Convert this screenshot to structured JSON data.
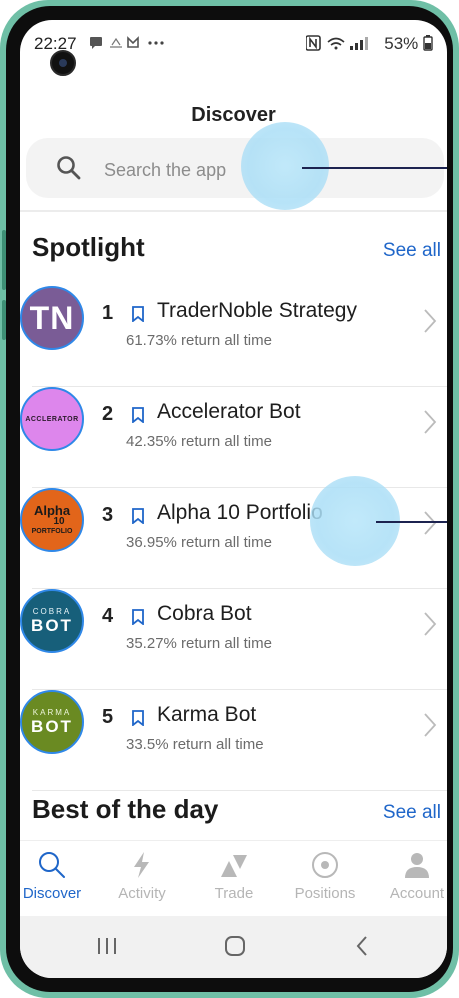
{
  "status_bar": {
    "time": "22:27",
    "battery": "53%"
  },
  "header": {
    "title": "Discover"
  },
  "search": {
    "placeholder": "Search the app"
  },
  "spotlight": {
    "title": "Spotlight",
    "see_all": "See all",
    "items": [
      {
        "rank": "1",
        "name": "TraderNoble Strategy",
        "subtitle": "61.73% return all time",
        "avatar_text": "TN",
        "avatar_color": "#7a5c96"
      },
      {
        "rank": "2",
        "name": "Accelerator Bot",
        "subtitle": "42.35% return all time",
        "avatar_text": "ACCLERATOR",
        "avatar_color": "#dd86ec"
      },
      {
        "rank": "3",
        "name": "Alpha 10 Portfolio",
        "subtitle": "36.95% return all time",
        "avatar_text_top": "Alpha",
        "avatar_text_mid": "10",
        "avatar_text_bot": "PORTFOLIO",
        "avatar_color": "#e2651a"
      },
      {
        "rank": "4",
        "name": "Cobra Bot",
        "subtitle": "35.27% return all time",
        "avatar_text_top": "COBRA",
        "avatar_text_bot": "BOT",
        "avatar_color": "#175f7a"
      },
      {
        "rank": "5",
        "name": "Karma Bot",
        "subtitle": "33.5% return all time",
        "avatar_text_top": "KARMA",
        "avatar_text_bot": "BOT",
        "avatar_color": "#6a8a22"
      }
    ]
  },
  "best_of_day": {
    "title": "Best of the day",
    "see_all": "See all"
  },
  "tabs": [
    {
      "label": "Discover",
      "icon": "search-icon",
      "active": true
    },
    {
      "label": "Activity",
      "icon": "lightning-icon",
      "active": false
    },
    {
      "label": "Trade",
      "icon": "trade-icon",
      "active": false
    },
    {
      "label": "Positions",
      "icon": "target-icon",
      "active": false
    },
    {
      "label": "Account",
      "icon": "person-icon",
      "active": false
    }
  ],
  "colors": {
    "accent": "#1f66c9",
    "frame": "#6fbfa6"
  }
}
